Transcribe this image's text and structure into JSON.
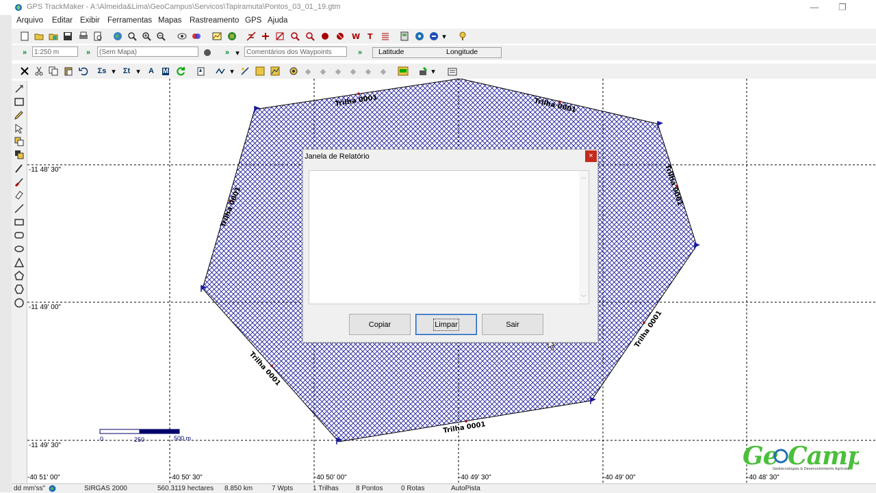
{
  "window": {
    "title": "GPS TrackMaker - A:\\Almeida&Lima\\GeoCampus\\Servicos\\Tapiramuta\\Pontos_03_01_19.gtm",
    "minimize": "—",
    "restore": "❐"
  },
  "menu": [
    "Arquivo",
    "Editar",
    "Exibir",
    "Ferramentas",
    "Mapas",
    "Rastreamento",
    "GPS",
    "Ajuda"
  ],
  "toolbar2": {
    "scale_value": "1:250 m",
    "map_value": "(Sem Mapa)",
    "waypoint_comment": "Comentários dos Waypoints",
    "latitude_label": "Latitude",
    "longitude_label": "Longitude"
  },
  "map": {
    "lat_labels": [
      "-11 48' 30\"",
      "-11 49' 00\"",
      "-11 49' 30\""
    ],
    "lon_labels": [
      "-40 51' 00\"",
      "-40 50' 30\"",
      "-40 50' 00\"",
      "-40 49' 30\"",
      "-40 49' 00\"",
      "-40 48' 30\""
    ],
    "track_label": "Trilha 0001",
    "scale_ticks": [
      "0",
      "250",
      "500 m"
    ],
    "polygon_color": "#1a1a9c"
  },
  "dialog": {
    "title": "Janela de Relatório",
    "close": "×",
    "buttons": {
      "copy": "Copiar",
      "clear": "Limpar",
      "exit": "Sair"
    }
  },
  "status": {
    "format": "dd mm'ss\"",
    "datum": "SIRGAS 2000",
    "area": "560.3119 hectares",
    "distance": "8.850 km",
    "waypoints": "7 Wpts",
    "tracks": "1 Trilhas",
    "points": "8 Pontos",
    "routes": "0 Rotas",
    "autotrack": "AutoPista"
  },
  "logo": {
    "text": "GeoCampus",
    "tagline": "Geotecnologias & Desenvolvimento Agrícola"
  }
}
